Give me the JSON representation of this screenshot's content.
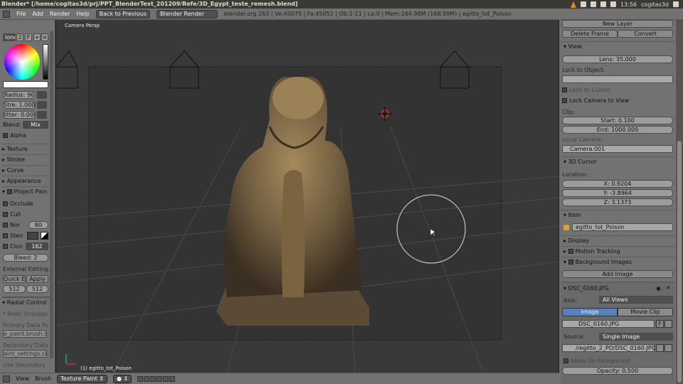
{
  "window": {
    "title": "Blender* [/home/cogitas3d/prj/PPT_BlenderText_201209/Refe/3D_Egypt_teste_remesh.blend]",
    "clock": "13:56",
    "user": "cogitas3d"
  },
  "menubar": {
    "items": [
      "File",
      "Add",
      "Render",
      "Help"
    ],
    "back_btn": "Back to Previous",
    "engine": "Blender Render",
    "info": "blender.org 263 | Ve:45075 | Fa:45052 | Ob:1-11 | La:0 | Mem:164.98M (168.99M) | egitto_tot_Poison"
  },
  "toolbar": {
    "brush_name": "lone",
    "brush_users": "2",
    "brush_fake": "F",
    "radius": "Radius: 96",
    "strength": "Stre: 1.000",
    "jitter": "Jitter: 0.000",
    "blend_label": "Blend:",
    "blend_value": "Mix",
    "alpha": "Alpha",
    "sections": [
      "Texture",
      "Stroke",
      "Curve",
      "Appearance"
    ],
    "project_paint": "Project Pain",
    "occlude": "Occlude",
    "cull": "Cull",
    "normal": "Nor",
    "normal_value": "80",
    "stencil": "Sten",
    "clone": "Clon",
    "clone_value": "162",
    "bleed": "Bleed: 2",
    "external_editing": "External Editing:",
    "quick_edit": "Quick Edi",
    "apply": "Apply",
    "size_x": "512",
    "size_y": "512",
    "radial_control": "Radial Control",
    "redo": "* Redo Unsupporte",
    "primary_label": "Primary Data Path",
    "primary_value": "e_paint.brush.size",
    "secondary_label": "Secondary Data Pa",
    "secondary_value": "aint_settings.size",
    "use_secondary": "Use Secondary"
  },
  "viewport": {
    "camera_label": "Camera Persp",
    "object_label": "(1) egitto_tot_Poison"
  },
  "props": {
    "new_layer": "New Layer",
    "delete_frame": "Delete Frame",
    "convert": "Convert",
    "view_hdr": "View",
    "lens": "Lens: 35.000",
    "lock_to_object": "Lock to Object:",
    "lock_to_cursor": "Lock to Cursor",
    "lock_camera": "Lock Camera to View",
    "clip": "Clip:",
    "clip_start": "Start: 0.100",
    "clip_end": "End: 1000.000",
    "local_camera": "Local Camera:",
    "camera_name": "Camera.001",
    "cursor_hdr": "3D Cursor",
    "location": "Location:",
    "cx": "X: 0.9204",
    "cy": "Y: -3.8964",
    "cz": "Z: 3.1373",
    "item_hdr": "Item",
    "item_name": "egitto_tot_Poison",
    "display_hdr": "Display",
    "motion_hdr": "Motion Tracking",
    "bg_hdr": "Background Images",
    "add_image": "Add Image",
    "image_name": "DSC_0160.JPG",
    "axis_label": "Axis:",
    "axis_value": "All Views",
    "tab_image": "Image",
    "tab_movie": "Movie Clip",
    "image_block": "DSC_0160.JPG",
    "fake": "F",
    "source_label": "Source:",
    "source_value": "Single Image",
    "path": "//egitto_2_PO/DSC_0160.JPG",
    "show_fg": "Show On Foreground",
    "opacity": "Opacity: 0.500"
  },
  "bottombar": {
    "view": "View",
    "brush": "Brush",
    "mode": "Texture Paint"
  },
  "colors": {
    "panel": "#727272",
    "viewport": "#393939",
    "accent": "#5680c2"
  }
}
